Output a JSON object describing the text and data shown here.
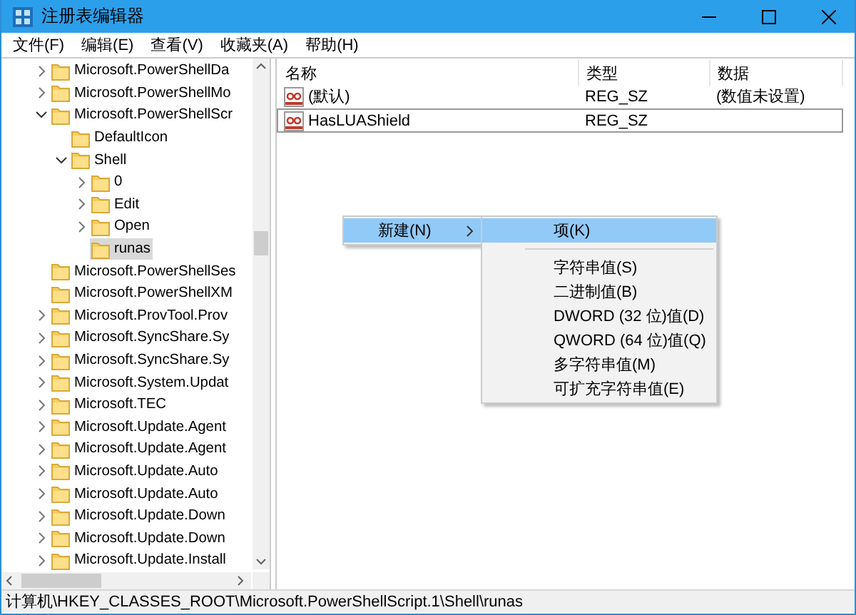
{
  "window": {
    "title": "注册表编辑器"
  },
  "menu_bar": [
    {
      "label": "文件(F)"
    },
    {
      "label": "编辑(E)"
    },
    {
      "label": "查看(V)"
    },
    {
      "label": "收藏夹(A)"
    },
    {
      "label": "帮助(H)"
    }
  ],
  "tree": {
    "items": [
      {
        "label": "Microsoft.PowerShellDa",
        "expandable": true,
        "expanded": false,
        "selected": false
      },
      {
        "label": "Microsoft.PowerShellMo",
        "expandable": true,
        "expanded": false,
        "selected": false
      },
      {
        "label": "Microsoft.PowerShellScr",
        "expandable": true,
        "expanded": true,
        "selected": false,
        "children": [
          {
            "label": "DefaultIcon",
            "expandable": false,
            "selected": false
          },
          {
            "label": "Shell",
            "expandable": true,
            "expanded": true,
            "selected": false,
            "children": [
              {
                "label": "0",
                "expandable": true,
                "expanded": false,
                "selected": false
              },
              {
                "label": "Edit",
                "expandable": true,
                "expanded": false,
                "selected": false
              },
              {
                "label": "Open",
                "expandable": true,
                "expanded": false,
                "selected": false
              },
              {
                "label": "runas",
                "expandable": false,
                "selected": true
              }
            ]
          }
        ]
      },
      {
        "label": "Microsoft.PowerShellSes",
        "expandable": false,
        "selected": false
      },
      {
        "label": "Microsoft.PowerShellXM",
        "expandable": false,
        "selected": false
      },
      {
        "label": "Microsoft.ProvTool.Prov",
        "expandable": true,
        "expanded": false,
        "selected": false
      },
      {
        "label": "Microsoft.SyncShare.Sy",
        "expandable": true,
        "expanded": false,
        "selected": false
      },
      {
        "label": "Microsoft.SyncShare.Sy",
        "expandable": true,
        "expanded": false,
        "selected": false
      },
      {
        "label": "Microsoft.System.Updat",
        "expandable": true,
        "expanded": false,
        "selected": false
      },
      {
        "label": "Microsoft.TEC",
        "expandable": true,
        "expanded": false,
        "selected": false
      },
      {
        "label": "Microsoft.Update.Agent",
        "expandable": true,
        "expanded": false,
        "selected": false
      },
      {
        "label": "Microsoft.Update.Agent",
        "expandable": true,
        "expanded": false,
        "selected": false
      },
      {
        "label": "Microsoft.Update.Auto",
        "expandable": true,
        "expanded": false,
        "selected": false
      },
      {
        "label": "Microsoft.Update.Auto",
        "expandable": true,
        "expanded": false,
        "selected": false
      },
      {
        "label": "Microsoft.Update.Down",
        "expandable": true,
        "expanded": false,
        "selected": false
      },
      {
        "label": "Microsoft.Update.Down",
        "expandable": true,
        "expanded": false,
        "selected": false
      },
      {
        "label": "Microsoft.Update.Install",
        "expandable": true,
        "expanded": false,
        "selected": false
      }
    ]
  },
  "values": {
    "columns": [
      "名称",
      "类型",
      "数据"
    ],
    "rows": [
      {
        "name": "(默认)",
        "type": "REG_SZ",
        "data": "(数值未设置)",
        "focused": false
      },
      {
        "name": "HasLUAShield",
        "type": "REG_SZ",
        "focused": true
      }
    ]
  },
  "context_menu": {
    "items": [
      {
        "label": "新建(N)",
        "has_submenu": true,
        "selected": true
      }
    ],
    "submenu": {
      "items": [
        {
          "kind": "item",
          "label": "项(K)",
          "selected": true
        },
        {
          "kind": "separator"
        },
        {
          "kind": "item",
          "label": "字符串值(S)",
          "selected": false
        },
        {
          "kind": "item",
          "label": "二进制值(B)",
          "selected": false
        },
        {
          "kind": "item",
          "label": "DWORD (32 位)值(D)",
          "selected": false
        },
        {
          "kind": "item",
          "label": "QWORD (64 位)值(Q)",
          "selected": false
        },
        {
          "kind": "item",
          "label": "多字符串值(M)",
          "selected": false
        },
        {
          "kind": "item",
          "label": "可扩充字符串值(E)",
          "selected": false
        }
      ]
    }
  },
  "status_bar": {
    "path": "计算机\\HKEY_CLASSES_ROOT\\Microsoft.PowerShellScript.1\\Shell\\runas"
  }
}
